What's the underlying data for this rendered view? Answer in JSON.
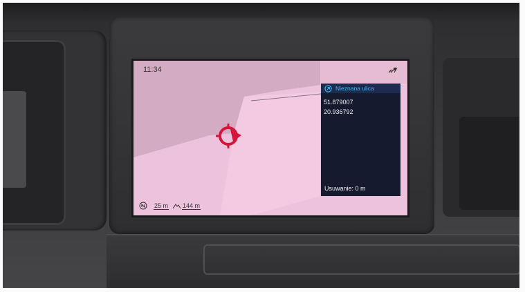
{
  "status_bar": {
    "time": "11:34",
    "signal_icon": "satellite-signal-icon"
  },
  "info_panel": {
    "nav_icon": "navigation-arrow-icon",
    "street": "Nieznana ulica",
    "latitude": "51.879007",
    "longitude": "20.936792",
    "distance": "Usuwanie: 0 m"
  },
  "scale_bar": {
    "compass_icon": "compass-north-icon",
    "scale": "25 m",
    "elevation_icon": "elevation-icon",
    "elevation": "144 m"
  },
  "map": {
    "position_marker_icon": "current-position-marker-icon"
  },
  "colors": {
    "screen_background": "#edc2dc",
    "map_dark_region": "#d1aac1",
    "info_panel_background": "#161a2e",
    "info_header_background": "#1d2b4e",
    "street_text": "#4cb3ee",
    "marker": "#d4163d"
  }
}
